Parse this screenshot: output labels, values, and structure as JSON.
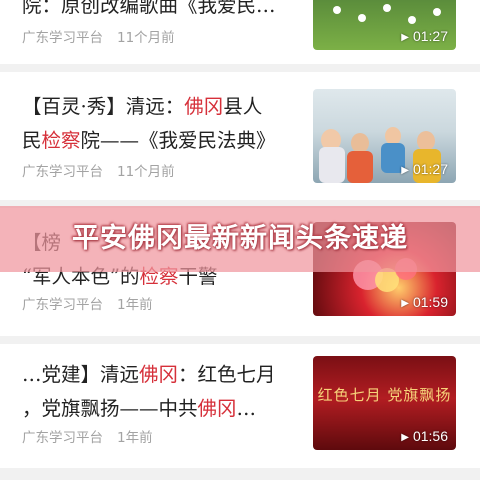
{
  "banner": {
    "title": "平安佛冈最新新闻头条速递"
  },
  "articles": [
    {
      "line1": {
        "a": "院：原创改编歌曲《我爱民…",
        "b": "",
        "c": "",
        "d": ""
      },
      "source": "广东学习平台",
      "time": "11个月前",
      "duration": "01:27"
    },
    {
      "line1": {
        "a": "【百灵·秀】清远：",
        "b": "佛冈",
        "c": "县人",
        "d": ""
      },
      "line2": {
        "a": "民",
        "b": "检察",
        "c": "院——《我爱民法典》"
      },
      "source": "广东学习平台",
      "time": "11个月前",
      "duration": "01:27"
    },
    {
      "line1": {
        "a": "【榜",
        "b": "",
        "c": "",
        "d": ""
      },
      "line2": {
        "a": "“军人本色”的",
        "b": "检察",
        "c": "干警"
      },
      "source": "广东学习平台",
      "time": "1年前",
      "duration": "01:59"
    },
    {
      "line1": {
        "a": "…党建】清远",
        "b": "佛冈",
        "c": "：红色七月",
        "d": ""
      },
      "line2": {
        "a": "，党旗飘扬——中共",
        "b": "佛冈",
        "c": "…"
      },
      "source": "广东学习平台",
      "time": "1年前",
      "duration": "01:56",
      "thumb_slogan": "红色七月  党旗飘扬"
    }
  ],
  "colors": {
    "highlight": "#d6303a",
    "meta": "#a3a3a3",
    "banner": "#f0969e"
  },
  "icons": {
    "play": "play-icon"
  }
}
